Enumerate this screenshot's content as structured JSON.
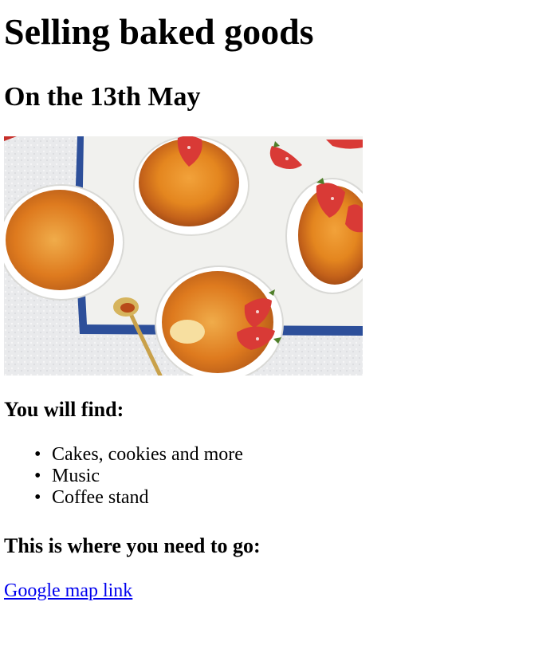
{
  "page": {
    "title": "Selling baked goods",
    "date_heading": "On the 13th May",
    "image": {
      "icon": "creme-brulee-photo"
    },
    "find_heading": "You will find:",
    "items": [
      "Cakes, cookies and more",
      "Music",
      "Coffee stand"
    ],
    "where_heading": "This is where you need to go:",
    "map_link_text": "Google map link",
    "colors": {
      "link": "#0000ee",
      "text": "#000000",
      "background": "#ffffff"
    }
  }
}
